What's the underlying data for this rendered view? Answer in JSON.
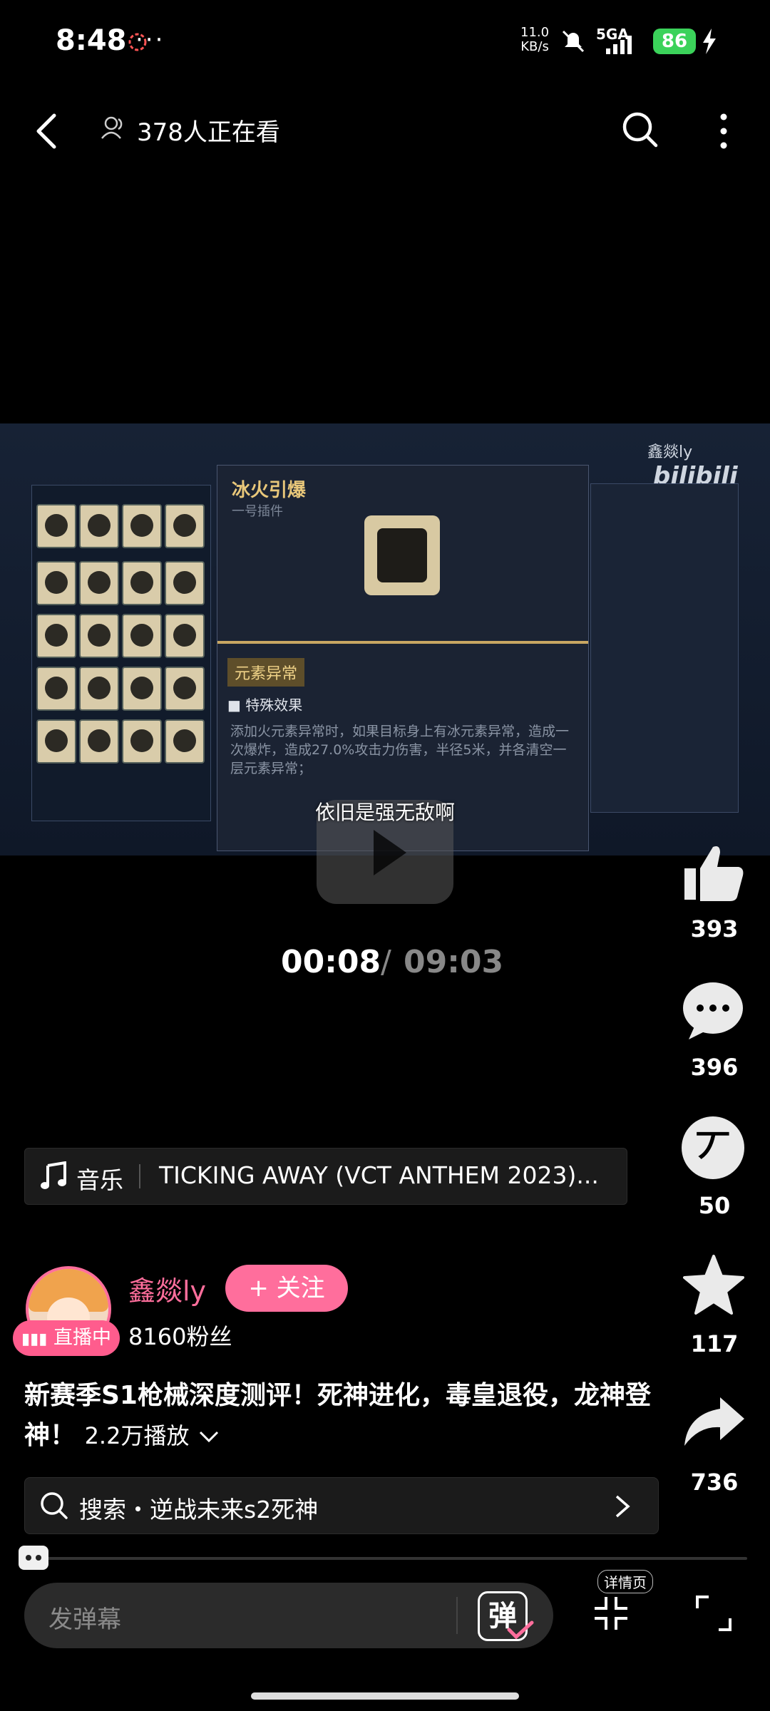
{
  "status_bar": {
    "time": "8:48",
    "overflow": "···",
    "net_speed_value": "11.0",
    "net_speed_unit": "KB/s",
    "signal": "5GA",
    "battery": "86"
  },
  "top_bar": {
    "viewers": "378人正在看"
  },
  "video": {
    "subtitle": "依旧是强无敌啊",
    "watermark_user": "鑫燚ly",
    "watermark_brand": "bilibili",
    "game_card_title": "冰火引爆",
    "game_card_sub": "一号插件",
    "game_tag": "元素异常",
    "game_effect_title": "■ 特殊效果",
    "game_effect_text": "添加火元素异常时，如果目标身上有冰元素异常，造成一次爆炸，造成27.0%攻击力伤害，半径5米，并各清空一层元素异常；",
    "progress_fraction": 0.0148
  },
  "time": {
    "current": "00:08",
    "separator": "/",
    "total": "09:03"
  },
  "actions": {
    "like": "393",
    "comment": "396",
    "coin": "50",
    "favorite": "117",
    "share": "736",
    "coin_glyph": "丆"
  },
  "music": {
    "label": "音乐",
    "song": "TICKING AWAY (VCT ANTHEM 2023)..."
  },
  "uploader": {
    "name": "鑫燚ly",
    "follow": "+ 关注",
    "live": "直播中",
    "fans": "8160粉丝"
  },
  "video_info": {
    "title": "新赛季S1枪械深度测评！死神进化，毒皇退役，龙神登神！",
    "plays": "2.2万播放"
  },
  "search": {
    "text": "搜索・逆战未来s2死神"
  },
  "bottom": {
    "danmaku_placeholder": "发弹幕",
    "danmaku_glyph": "弹",
    "detail": "详情页"
  },
  "colors": {
    "accent": "#ff6e9c",
    "battery": "#3bd25a"
  }
}
